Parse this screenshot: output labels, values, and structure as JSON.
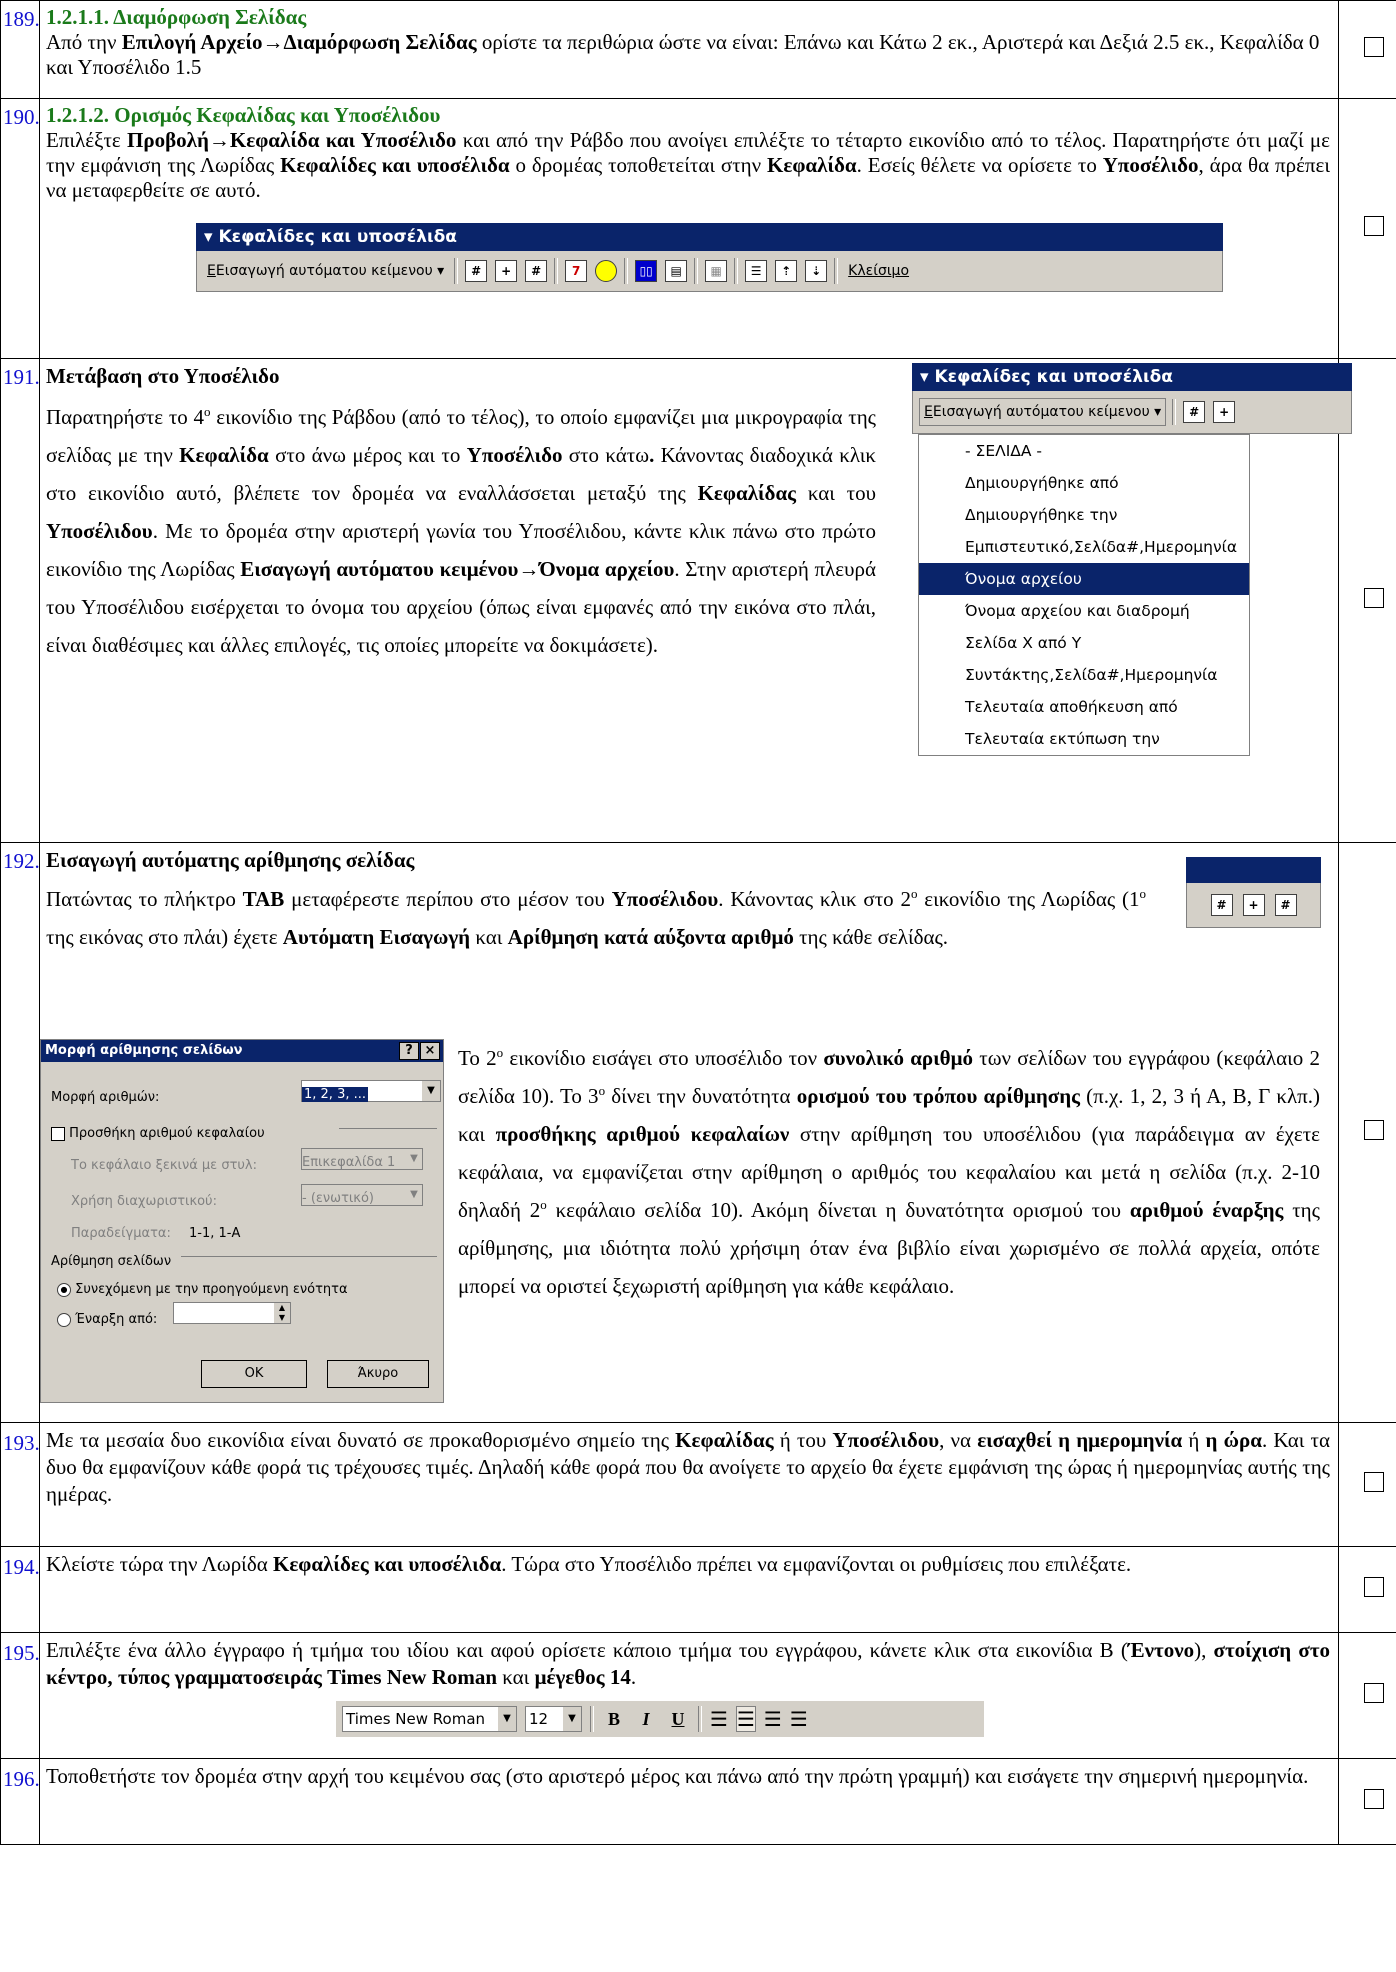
{
  "rows": [
    {
      "num": "189.",
      "heading": "1.2.1.1. Διαμόρφωση Σελίδας",
      "t1": "Από την ",
      "b1": "Επιλογή Αρχείο→Διαμόρφωση Σελίδας",
      "t2": " ορίστε τα περιθώρια ώστε να είναι: Επάνω και Κάτω 2 εκ., Αριστερά και Δεξιά 2.5 εκ., Κεφαλίδα 0 και Υποσέλιδο 1.5"
    },
    {
      "num": "190.",
      "heading": "1.2.1.2. Ορισμός Κεφαλίδας και Υποσέλιδου",
      "t1": "Επιλέξτε ",
      "b1": "Προβολή→Κεφαλίδα και Υποσέλιδο",
      "t2": " και από την Ράβδο που ανοίγει επιλέξτε το τέταρτο εικονίδιο από το τέλος. Παρατηρήστε ότι μαζί με την εμφάνιση της Λωρίδας ",
      "b2": "Κεφαλίδες και υποσέλιδα",
      "t3": " ο δρομέας τοποθετείται στην ",
      "b3": "Κεφαλίδα",
      "t4": ". Εσείς θέλετε να ορίσετε το ",
      "b4": "Υποσέλιδο",
      "t5": ", άρα θα πρέπει να μεταφερθείτε σε αυτό."
    },
    {
      "num": "191.",
      "heading": "Μετάβαση στο Υποσέλιδο",
      "p1": "Παρατηρήστε το 4",
      "sup": "ο",
      "p2": " εικονίδιο της Ράβδου (από το τέλος), το οποίο εμφανίζει μια μικρογραφία της σελίδας με την ",
      "b1": "Κεφαλίδα",
      "p3": " στο άνω μέρος και το ",
      "b2": "Υποσέλιδο",
      "p4": " στο κάτω",
      "b3": ".",
      "p5": " Κάνοντας διαδοχικά κλικ στο εικονίδιο αυτό, βλέπετε τον δρομέα να εναλλάσσεται μεταξύ της ",
      "b4": "Κεφαλίδας",
      "p6": " και του ",
      "b5": "Υποσέλιδου",
      "p7": ". Με το δρομέα στην αριστερή γωνία του Υποσέλιδου, κάντε κλικ πάνω στο πρώτο εικονίδιο της Λωρίδας ",
      "b6": "Εισαγωγή αυτόματου κειμένου→Όνομα αρχείου",
      "p8": ". Στην αριστερή πλευρά του Υποσέλιδου εισέρχεται το όνομα του αρχείου (όπως είναι εμφανές από την εικόνα στο πλάι, είναι διαθέσιμες και άλλες επιλογές, τις οποίες μπορείτε να δοκιμάσετε)."
    },
    {
      "num": "192.",
      "heading": "Εισαγωγή αυτόματης αρίθμησης σελίδας",
      "a1": "Πατώντας το πλήκτρο ",
      "ab1": "TAB",
      "a2": " μεταφέρεστε περίπου στο μέσον του ",
      "ab2": "Υποσέλιδου",
      "a3": ". Κάνοντας κλικ στο 2",
      "asup1": "ο",
      "a4": " εικονίδιο της Λωρίδας (1",
      "asup2": "ο",
      "a5": " της εικόνας στο πλάι) έχετε ",
      "ab3": "Αυτόματη Εισαγωγή",
      "a6": " και ",
      "ab4": "Αρίθμηση κατά αύξοντα αριθμό",
      "a7": " της κάθε σελίδας.",
      "c1": "Το 2",
      "csup1": "ο",
      "c2": " εικονίδιο εισάγει στο υποσέλιδο τον ",
      "cb1": "συνολικό αριθμό",
      "c3": " των σελίδων του εγγράφου (κεφάλαιο 2 σελίδα 10). Το 3",
      "csup2": "ο",
      "c4": " δίνει την δυνατότητα ",
      "cb2": "ορισμού του τρόπου αρίθμησης",
      "c5": " (π.χ. 1, 2, 3 ή Α, Β, Γ κλπ.) και ",
      "cb3": "προσθήκης αριθμού κεφαλαίων",
      "c6": " στην αρίθμηση του υποσέλιδου (για παράδειγμα αν έχετε κεφάλαια, να εμφανίζεται στην αρίθμηση ο αριθμός του κεφαλαίου και μετά η σελίδα (π.χ. 2-10 δηλαδή 2",
      "csup3": "ο",
      "c7": " κεφάλαιο σελίδα 10). Ακόμη δίνεται η δυνατότητα ορισμού του ",
      "cb4": "αριθμού έναρξης",
      "c8": " της αρίθμησης, μια ιδιότητα πολύ χρήσιμη όταν ένα βιβλίο είναι χωρισμένο σε πολλά αρχεία, οπότε μπορεί να οριστεί ξεχωριστή αρίθμηση για κάθε κεφάλαιο."
    },
    {
      "num": "193.",
      "t1": "Με τα μεσαία δυο εικονίδια είναι δυνατό σε προκαθορισμένο σημείο της ",
      "b1": "Κεφαλίδας",
      "t2": " ή του ",
      "b2": "Υποσέλιδου",
      "t3": ", να ",
      "b3": "εισαχθεί η ημερομηνία",
      "t4": " ή ",
      "b4": "η ώρα",
      "t5": ". Και τα δυο θα εμφανίζουν κάθε φορά τις τρέχουσες τιμές. Δηλαδή κάθε φορά που θα ανοίγετε το αρχείο θα έχετε εμφάνιση της ώρας ή ημερομηνίας αυτής της ημέρας."
    },
    {
      "num": "194.",
      "t1": "Κλείστε τώρα την Λωρίδα ",
      "b1": "Κεφαλίδες και υποσέλιδα",
      "t2": ". Τώρα στο Υποσέλιδο πρέπει να εμφανίζονται οι ρυθμίσεις που επιλέξατε."
    },
    {
      "num": "195.",
      "t1": " Επιλέξτε ένα άλλο έγγραφο ή τμήμα του ιδίου και αφού ορίσετε κάποιο τμήμα του εγγράφου,  κάνετε κλικ στα εικονίδια Β (",
      "b1": "Έντονο",
      "t2": "), ",
      "b2": "στοίχιση στο κέντρο, τύπος γραμματοσειράς Times New Roman",
      "t3": " και ",
      "b3": "μέγεθος 14",
      "t4": "."
    },
    {
      "num": "196.",
      "t1": "Τοποθετήστε τον δρομέα στην αρχή του κειμένου σας (στο αριστερό μέρος και πάνω από την πρώτη γραμμή) και εισάγετε την σημερινή ημερομηνία."
    }
  ],
  "toolbar": {
    "title": "Κεφαλίδες και υποσέλιδα",
    "autotext_label": "Εισαγωγή αυτόματου κείμενου",
    "close_label": "Κλείσιμο"
  },
  "autotext_menu": {
    "items": [
      "- ΣΕΛΙΔΑ -",
      "Δημιουργήθηκε από",
      "Δημιουργήθηκε την",
      "Εμπιστευτικό,Σελίδα#,Ημερομηνία",
      "Όνομα αρχείου",
      "Όνομα αρχείου και διαδρομή",
      "Σελίδα Χ από Υ",
      "Συντάκτης,Σελίδα#,Ημερομηνία",
      "Τελευταία αποθήκευση από",
      "Τελευταία εκτύπωση την"
    ],
    "selected_index": 4
  },
  "dialog": {
    "title": "Μορφή αρίθμησης σελίδων",
    "help_btn": "?",
    "close_btn": "×",
    "format_label": "Μορφή αριθμών:",
    "format_value": "1, 2, 3, ...",
    "include_chapter_label": "Προσθήκη αριθμού κεφαλαίου",
    "chapter_starts_label": "Το κεφάλαιο ξεκινά με στυλ:",
    "chapter_starts_value": "Επικεφαλίδα 1",
    "separator_label": "Χρήση διαχωριστικού:",
    "separator_value": "-  (ενωτικό)",
    "examples_label": "Παραδείγματα:",
    "examples_value": "1-1, 1-A",
    "page_numbering_label": "Αρίθμηση σελίδων",
    "continue_label": "Συνεχόμενη με την προηγούμενη ενότητα",
    "start_at_label": "Έναρξη από:",
    "ok_label": "OK",
    "cancel_label": "Άκυρο"
  },
  "format_toolbar": {
    "font": "Times New Roman",
    "size": "12",
    "bold": "B",
    "italic": "I",
    "underline": "U"
  }
}
